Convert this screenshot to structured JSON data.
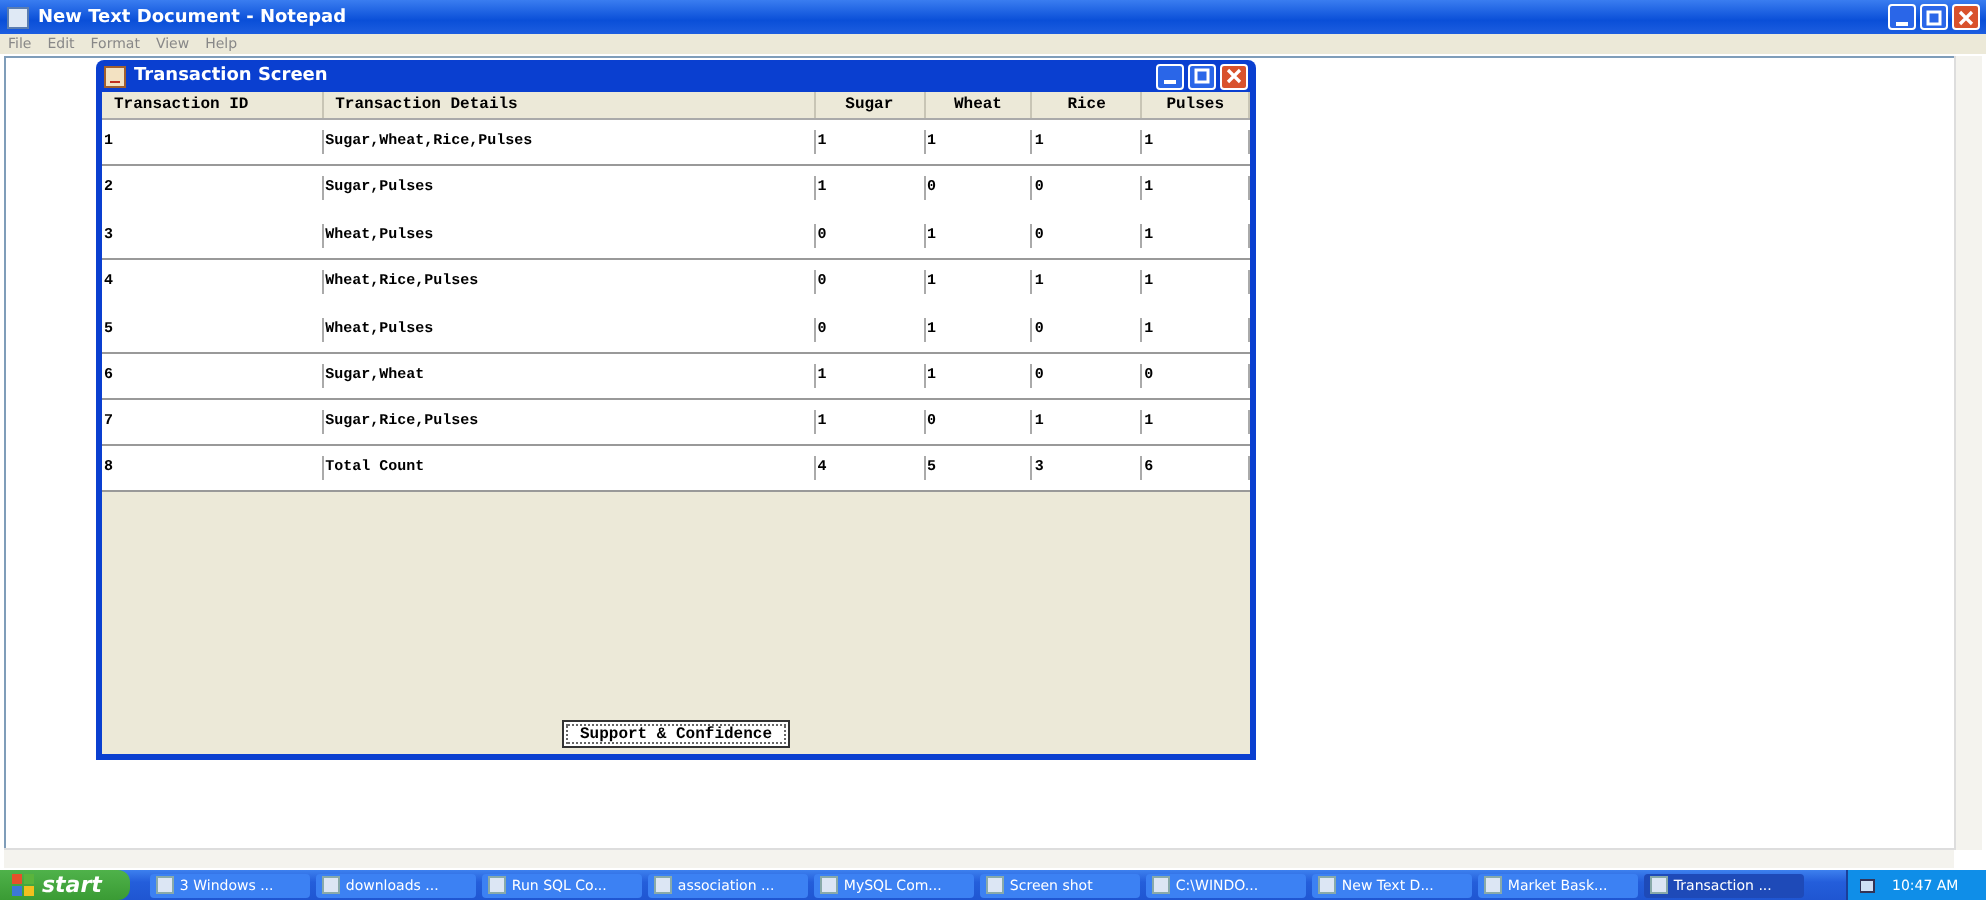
{
  "window": {
    "title": "New Text Document - Notepad"
  },
  "menu": [
    "File",
    "Edit",
    "Format",
    "View",
    "Help"
  ],
  "dialog": {
    "title": "Transaction Screen",
    "columns": [
      "Transaction ID",
      "Transaction Details",
      "Sugar",
      "Wheat",
      "Rice",
      "Pulses"
    ],
    "row_groups": [
      [
        [
          "1",
          "Sugar,Wheat,Rice,Pulses",
          "1",
          "1",
          "1",
          "1"
        ]
      ],
      [
        [
          "2",
          "Sugar,Pulses",
          "1",
          "0",
          "0",
          "1"
        ],
        [
          "3",
          "Wheat,Pulses",
          "0",
          "1",
          "0",
          "1"
        ]
      ],
      [
        [
          "4",
          "Wheat,Rice,Pulses",
          "0",
          "1",
          "1",
          "1"
        ],
        [
          "5",
          "Wheat,Pulses",
          "0",
          "1",
          "0",
          "1"
        ]
      ],
      [
        [
          "6",
          "Sugar,Wheat",
          "1",
          "1",
          "0",
          "0"
        ]
      ],
      [
        [
          "7",
          "Sugar,Rice,Pulses",
          "1",
          "0",
          "1",
          "1"
        ]
      ],
      [
        [
          "8",
          "Total Count",
          "4",
          "5",
          "3",
          "6"
        ]
      ]
    ],
    "button": "Support & Confidence"
  },
  "taskbar": {
    "start": "start",
    "items": [
      {
        "label": "3 Windows ...",
        "selected": false
      },
      {
        "label": "downloads ...",
        "selected": false
      },
      {
        "label": "Run SQL Co...",
        "selected": false
      },
      {
        "label": "association ...",
        "selected": false
      },
      {
        "label": "MySQL Com...",
        "selected": false
      },
      {
        "label": "Screen shot",
        "selected": false
      },
      {
        "label": "C:\\WINDO...",
        "selected": false
      },
      {
        "label": "New Text D...",
        "selected": false
      },
      {
        "label": "Market Bask...",
        "selected": false
      },
      {
        "label": "Transaction ...",
        "selected": true
      }
    ],
    "clock": "10:47 AM"
  }
}
